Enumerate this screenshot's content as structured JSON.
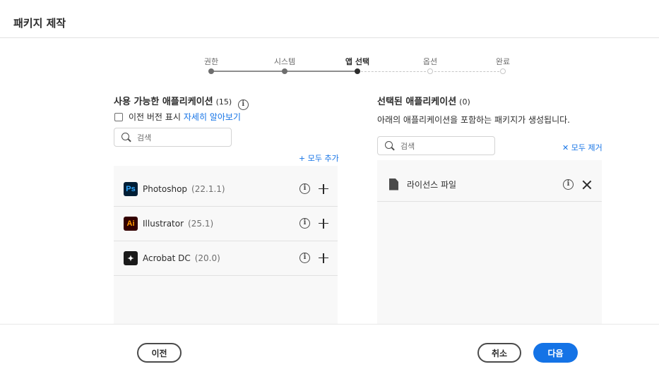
{
  "header": {
    "title": "패키지 제작"
  },
  "stepper": {
    "steps": [
      {
        "label": "권한",
        "state": "done"
      },
      {
        "label": "시스템",
        "state": "done"
      },
      {
        "label": "앱 선택",
        "state": "current"
      },
      {
        "label": "옵션",
        "state": "todo"
      },
      {
        "label": "완료",
        "state": "todo"
      }
    ]
  },
  "available": {
    "title": "사용 가능한 애플리케이션",
    "count": "(15)",
    "show_previous_label": "이전 버전 표시",
    "learn_more_link": "자세히 알아보기",
    "search_placeholder": "검색",
    "add_all_label": "+ 모두 추가",
    "apps": [
      {
        "name": "Photoshop",
        "version": "(22.1.1)",
        "icon": "photoshop-icon",
        "abbr": "Ps",
        "bg": "#001e36",
        "fg": "#31a8ff"
      },
      {
        "name": "Illustrator",
        "version": "(25.1)",
        "icon": "illustrator-icon",
        "abbr": "Ai",
        "bg": "#330000",
        "fg": "#ff9a00"
      },
      {
        "name": "Acrobat DC",
        "version": "(20.0)",
        "icon": "acrobat-icon",
        "abbr": "✦",
        "bg": "#1a1a1a",
        "fg": "#ffffff"
      }
    ]
  },
  "selected": {
    "title": "선택된 애플리케이션",
    "count": "(0)",
    "description": "아래의 애플리케이션을 포함하는 패키지가 생성됩니다.",
    "search_placeholder": "검색",
    "remove_all_label": "✕ 모두 제거",
    "items": [
      {
        "name": "라이선스 파일",
        "icon": "file-icon"
      }
    ]
  },
  "footer": {
    "back_label": "이전",
    "cancel_label": "취소",
    "next_label": "다음"
  },
  "colors": {
    "accent": "#1473e6"
  }
}
